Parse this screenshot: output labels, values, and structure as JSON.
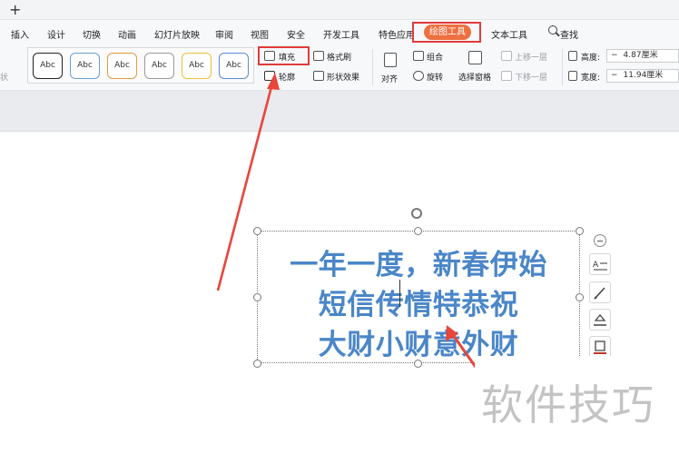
{
  "topbar": {
    "new_tab": "+"
  },
  "menu": {
    "items": [
      "插入",
      "设计",
      "切换",
      "动画",
      "幻灯片放映",
      "审阅",
      "视图",
      "安全",
      "开发工具",
      "特色应用"
    ],
    "active_tab": "绘图工具",
    "after_active": "文本工具",
    "search_label": "查找"
  },
  "ribbon": {
    "left_cut": "状",
    "style_samples": [
      "Abc",
      "Abc",
      "Abc",
      "Abc",
      "Abc",
      "Abc"
    ],
    "fill": "填充",
    "format_painter": "格式刷",
    "outline": "轮廓",
    "shape_effects": "形状效果",
    "align": "对齐",
    "group": "组合",
    "rotate": "旋转",
    "selection_pane": "选择窗格",
    "bring_forward": "上移一层",
    "send_backward": "下移一层",
    "height_label": "高度:",
    "height_value": "4.87厘米",
    "width_label": "宽度:",
    "width_value": "11.94厘米"
  },
  "slide": {
    "text_lines": [
      "一年一度，新春伊始",
      "短信传情特恭祝",
      "大财小财意外财"
    ]
  },
  "watermark": "软件技巧",
  "colors": {
    "accent": "#ed7040",
    "highlight": "#e03b3b",
    "text_blue": "#4a86c8"
  }
}
